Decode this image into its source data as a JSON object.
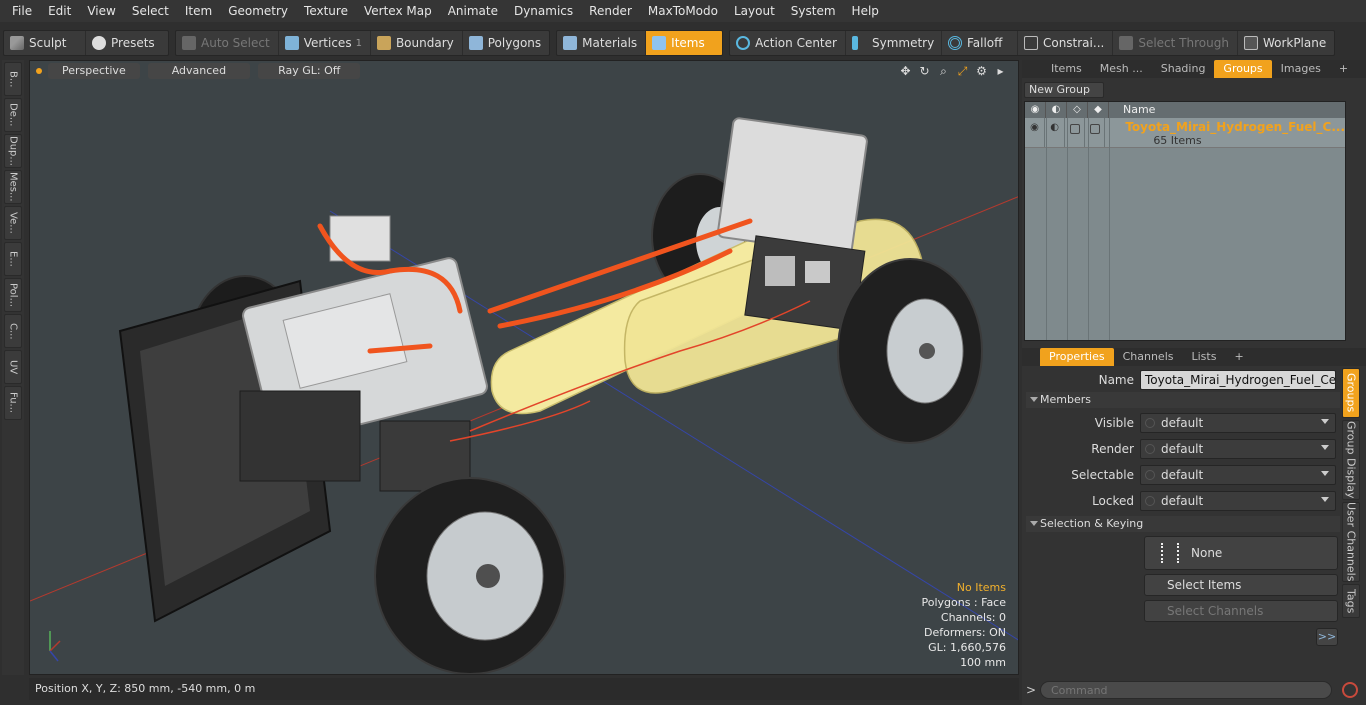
{
  "menubar": {
    "items": [
      "File",
      "Edit",
      "View",
      "Select",
      "Item",
      "Geometry",
      "Texture",
      "Vertex Map",
      "Animate",
      "Dynamics",
      "Render",
      "MaxToModo",
      "Layout",
      "System",
      "Help"
    ]
  },
  "toolbar": {
    "sculpt": "Sculpt",
    "presets": "Presets",
    "auto_select": "Auto Select",
    "vertices": "Vertices",
    "vertices_count": "1",
    "boundary": "Boundary",
    "polygons": "Polygons",
    "materials": "Materials",
    "items": "Items",
    "action_center": "Action Center",
    "symmetry": "Symmetry",
    "falloff": "Falloff",
    "constraints": "Constrai...",
    "select_through": "Select Through",
    "workplane": "WorkPlane"
  },
  "left_tabs": [
    "B...",
    "De...",
    "Dup...",
    "Mes...",
    "Ve...",
    "E...",
    "Pol...",
    "C...",
    "UV",
    "Fu..."
  ],
  "viewport": {
    "view_mode": "Perspective",
    "shading": "Advanced",
    "raygl": "Ray GL: Off",
    "icons": [
      "move-icon",
      "rotate-icon",
      "zoom-icon",
      "maximize-icon",
      "settings-icon",
      "play-icon"
    ],
    "info": {
      "selection": "No Items",
      "polygons": "Polygons : Face",
      "channels": "Channels: 0",
      "deformers": "Deformers: ON",
      "gl": "GL: 1,660,576",
      "scale": "100 mm"
    }
  },
  "statusbar": {
    "position": "Position X, Y, Z:  850 mm, -540 mm, 0 m"
  },
  "right_panel": {
    "top_tabs": [
      "Items",
      "Mesh ...",
      "Shading",
      "Groups",
      "Images"
    ],
    "top_tab_selected": "Groups",
    "new_group": "New Group",
    "table_header": {
      "name": "Name"
    },
    "group": {
      "name": "Toyota_Mirai_Hydrogen_Fuel_C...",
      "count": "65 Items"
    },
    "props_tabs": [
      "Properties",
      "Channels",
      "Lists"
    ],
    "props_tab_selected": "Properties",
    "properties": {
      "name_label": "Name",
      "name_value": "Toyota_Mirai_Hydrogen_Fuel_Cell_Sy",
      "members_section": "Members",
      "visible_label": "Visible",
      "visible_value": "default",
      "render_label": "Render",
      "render_value": "default",
      "selectable_label": "Selectable",
      "selectable_value": "default",
      "locked_label": "Locked",
      "locked_value": "default",
      "selection_section": "Selection & Keying",
      "keying_value": "None",
      "select_items": "Select Items",
      "select_channels": "Select Channels",
      "more": ">>"
    },
    "side_tabs": [
      "Groups",
      "Group Display",
      "User Channels",
      "Tags"
    ],
    "side_tab_selected": "Groups"
  },
  "command": {
    "placeholder": "Command",
    "prompt": ">"
  },
  "colors": {
    "accent": "#f1a21d",
    "hose": "#f0541e",
    "tank": "#f4eaa0",
    "viewport_bg": "#3d4447"
  }
}
